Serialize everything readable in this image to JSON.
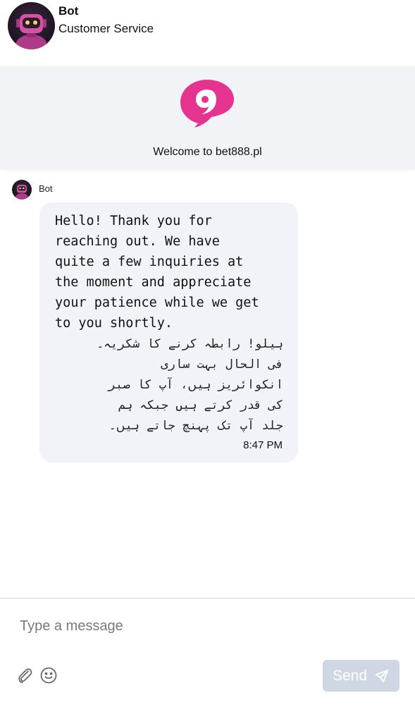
{
  "header": {
    "name": "Bot",
    "subtitle": "Customer Service"
  },
  "banner": {
    "logo": "chat-bubble-logo",
    "welcome_text": "Welcome to bet888.pl"
  },
  "messages": [
    {
      "sender": "Bot",
      "text_en": "Hello! Thank you for\nreaching out. We have\nquite a few inquiries at\nthe moment and appreciate\nyour patience while we get\nto you shortly.",
      "text_ur": "ہیلو! رابطہ کرنے کا شکریہ۔\nفی الحال بہت ساری\nانکوائریز ہیں، آپ کا صبر\nکی قدر کرتے ہیں جبکہ ہم\nجلد آپ تک پہنچ جاتے ہیں۔",
      "time": "8:47 PM"
    }
  ],
  "composer": {
    "placeholder": "Type a message",
    "send_label": "Send",
    "icons": [
      "attachment-icon",
      "emoji-icon",
      "send-plane-icon"
    ]
  },
  "colors": {
    "brand_pink": "#e5348f",
    "bubble_bg": "#f1f3f8",
    "banner_bg": "#f1f3f7",
    "send_disabled": "#cfd7e4"
  }
}
